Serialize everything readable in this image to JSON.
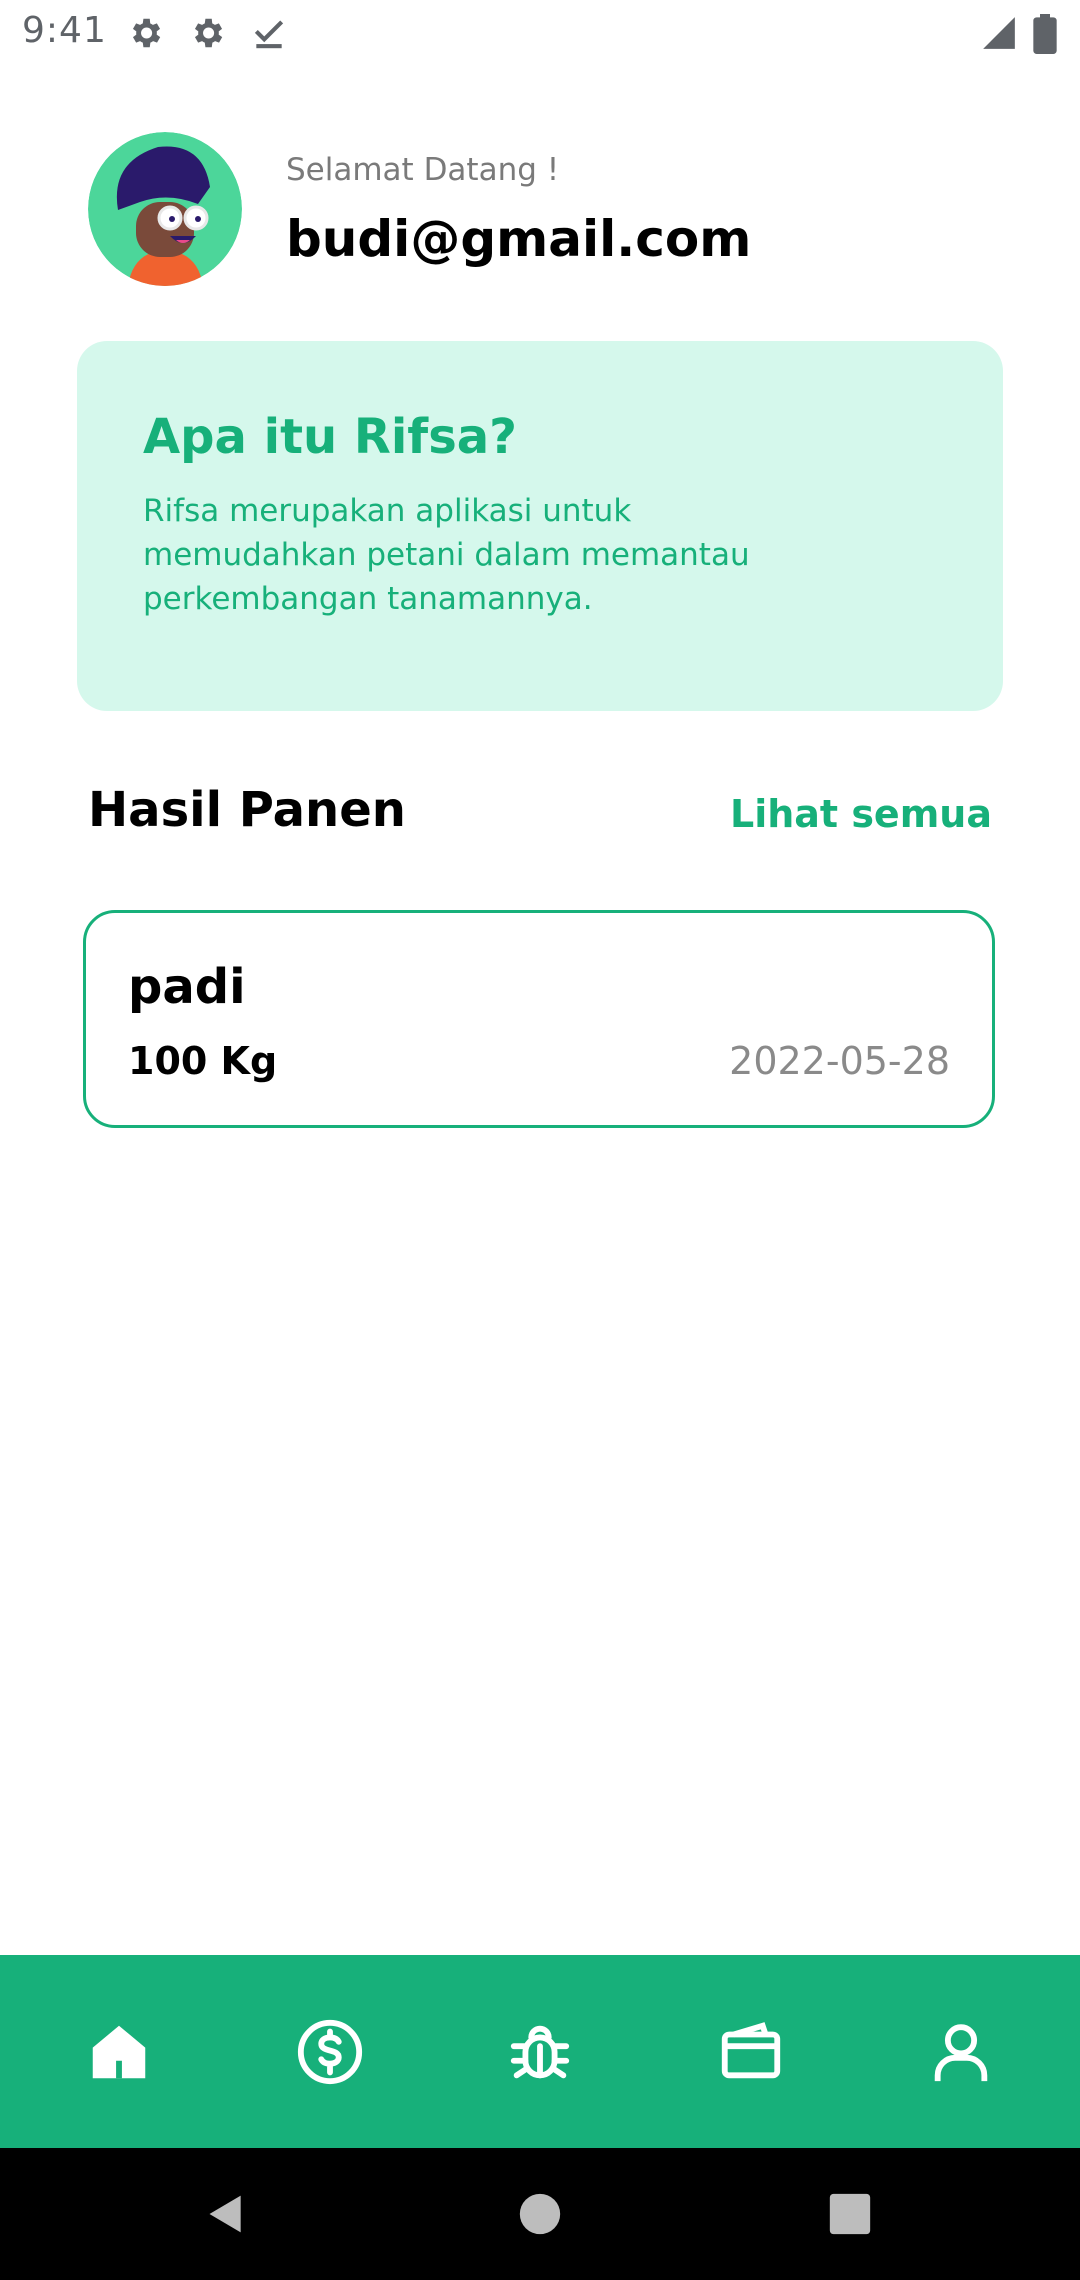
{
  "status_bar": {
    "time": "9:41",
    "icons": [
      "gear-icon",
      "gear-icon",
      "download-done-icon",
      "signal-icon",
      "battery-icon"
    ]
  },
  "profile": {
    "greeting": "Selamat Datang !",
    "email": "budi@gmail.com",
    "avatar_bg": "#4cd69a"
  },
  "info_card": {
    "title": "Apa itu Rifsa?",
    "body": "Rifsa merupakan aplikasi untuk memudahkan petani dalam memantau perkembangan tanamannya.",
    "bg_color": "#d5f8ec",
    "text_color": "#17b07a"
  },
  "harvest_section": {
    "title": "Hasil Panen",
    "see_all_label": "Lihat semua",
    "items": [
      {
        "name": "padi",
        "quantity": "100 Kg",
        "date": "2022-05-28"
      }
    ]
  },
  "bottom_nav": {
    "bg_color": "#17b07a",
    "items": [
      {
        "icon": "home-icon",
        "active": true
      },
      {
        "icon": "dollar-icon",
        "active": false
      },
      {
        "icon": "bug-icon",
        "active": false
      },
      {
        "icon": "wallet-icon",
        "active": false
      },
      {
        "icon": "user-icon",
        "active": false
      }
    ]
  },
  "system_nav": {
    "items": [
      "back-icon",
      "home-circle-icon",
      "recents-square-icon"
    ]
  }
}
